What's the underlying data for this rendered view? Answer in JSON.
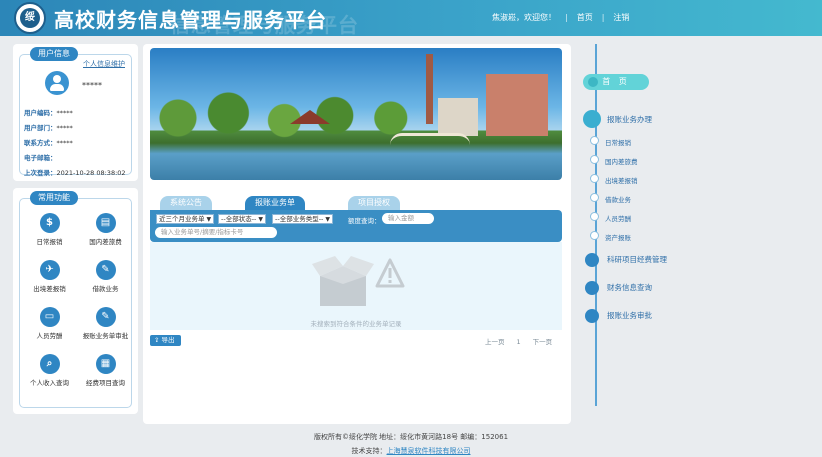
{
  "header": {
    "title": "高校财务信息管理与服务平台",
    "title_watermark": "信息管理与服务平台",
    "logo_text": "绥",
    "welcome": "焦淑崧，欢迎您！",
    "home_link": "首页",
    "logout_link": "注销"
  },
  "user_panel": {
    "tag": "用户信息",
    "profile_link": "个人信息维护",
    "name": "*****",
    "rows": [
      {
        "label": "用户编码：",
        "value": "*****"
      },
      {
        "label": "用户部门：",
        "value": "*****"
      },
      {
        "label": "联系方式：",
        "value": "*****"
      },
      {
        "label": "电子邮箱：",
        "value": ""
      },
      {
        "label": "上次登录：",
        "value": "2021-10-28 08:38:02"
      }
    ]
  },
  "func_panel": {
    "tag": "常用功能",
    "items": [
      {
        "label": "日常报销",
        "icon": "dollar-icon",
        "glyph": "$"
      },
      {
        "label": "国内差旅费",
        "icon": "bus-icon",
        "glyph": "▤"
      },
      {
        "label": "出境差报销",
        "icon": "plane-icon",
        "glyph": "✈"
      },
      {
        "label": "借款业务",
        "icon": "edit-icon",
        "glyph": "✎"
      },
      {
        "label": "人员劳酬",
        "icon": "id-card-icon",
        "glyph": "▭"
      },
      {
        "label": "报账业务单审批",
        "icon": "approve-icon",
        "glyph": "✎"
      },
      {
        "label": "个人收入查询",
        "icon": "search-doc-icon",
        "glyph": "⌕"
      },
      {
        "label": "经费项目查询",
        "icon": "project-icon",
        "glyph": "▦"
      }
    ]
  },
  "tabs": [
    {
      "label": "系统公告",
      "active": false
    },
    {
      "label": "报账业务单",
      "active": true
    },
    {
      "label": "项目授权",
      "active": false
    }
  ],
  "filters": {
    "period": "近三个月业务单",
    "status": "--全部状态--",
    "type": "--全部业务类型--",
    "amount_label": "额度查询：",
    "amount_placeholder": "输入金额",
    "search_placeholder": "输入业务单号/摘要/指标卡号"
  },
  "list": {
    "empty_text": "未搜索到符合条件的业务单记录"
  },
  "export_label": "导出",
  "pager": {
    "prev": "上一页",
    "page": "1",
    "next": "下一页"
  },
  "nav": {
    "home": "首  页",
    "sections": [
      {
        "label": "报账业务办理"
      },
      {
        "label": "科研项目经费管理"
      },
      {
        "label": "财务信息查询"
      },
      {
        "label": "报账业务审批"
      }
    ],
    "sub_items": [
      "日常报销",
      "国内差旅费",
      "出境差报销",
      "借款业务",
      "人员劳酬",
      "资产报账"
    ]
  },
  "footer": {
    "line1": "版权所有©绥化学院    地址：绥化市黄河路18号    邮编：152061",
    "support_label": "技术支持：",
    "support_link": "上海慧泉软件科技有限公司"
  }
}
